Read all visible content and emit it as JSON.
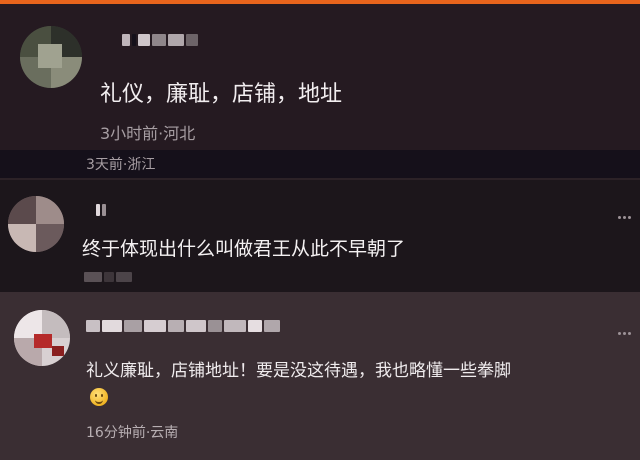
{
  "comments": [
    {
      "text": "礼仪，廉耻，店铺，地址",
      "meta": "3小时前·河北"
    },
    {
      "text": "终于体现出什么叫做君王从此不早朝了"
    },
    {
      "text": "礼义廉耻，店铺地址！要是没这待遇，我也略懂一些拳脚",
      "meta": "16分钟前·云南",
      "emoji": "smiling-face-emoji"
    }
  ],
  "overlay_meta": "3天前·浙江",
  "icons": [
    "more-icon",
    "avatar-icon",
    "smiling-face-emoji"
  ],
  "colors": {
    "accent_bar": "#e8641c",
    "background": "#120d10",
    "text_primary": "#f2eef0",
    "text_meta": "#a79ea3"
  }
}
